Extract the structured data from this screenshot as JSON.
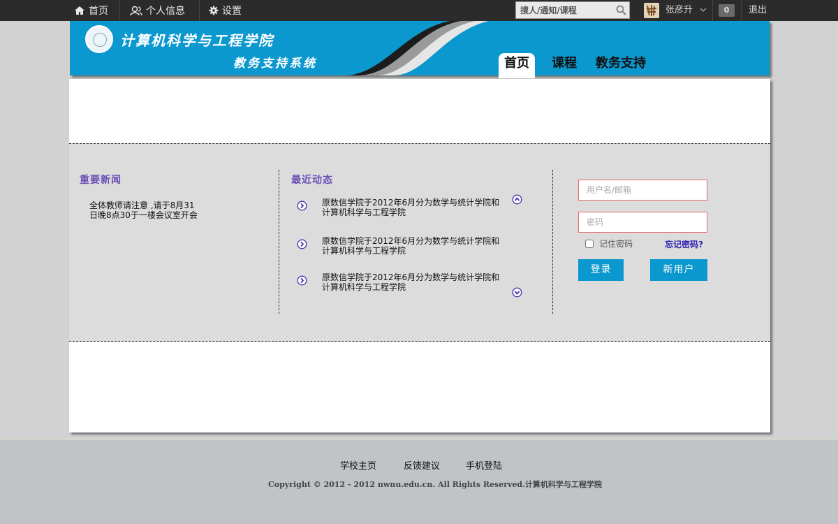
{
  "topbar": {
    "home": "首页",
    "profile": "个人信息",
    "settings": "设置",
    "search_placeholder": "搜人/通知/课程",
    "username": "张彦升",
    "notification_count": "0",
    "logout": "退出"
  },
  "header": {
    "title": "计算机科学与工程学院",
    "subtitle": "教务支持系统",
    "tabs": [
      "首页",
      "课程",
      "教务支持"
    ],
    "active_tab": "首页",
    "colors": {
      "banner": "#0b98cf",
      "accent": "#6b4fb8"
    }
  },
  "news": {
    "title": "重要新闻",
    "body": "全体教师请注意 ,请于8月31日晚8点30于一楼会议室开会"
  },
  "updates": {
    "title": "最近动态",
    "items": [
      "原数信学院于2012年6月分为数学与统计学院和计算机科学与工程学院",
      "原数信学院于2012年6月分为数学与统计学院和计算机科学与工程学院",
      "原数信学院于2012年6月分为数学与统计学院和计算机科学与工程学院"
    ]
  },
  "login": {
    "username_placeholder": "用户名/邮箱",
    "password_placeholder": "密码",
    "remember": "记住密码",
    "forgot": "忘记密码?",
    "login_button": "登录",
    "register_button": "新用户"
  },
  "footer": {
    "links": [
      "学校主页",
      "反馈建议",
      "手机登陆"
    ],
    "copyright": "Copyright © 2012 - 2012 nwnu.edu.cn. All Rights Reserved.计算机科学与工程学院"
  }
}
